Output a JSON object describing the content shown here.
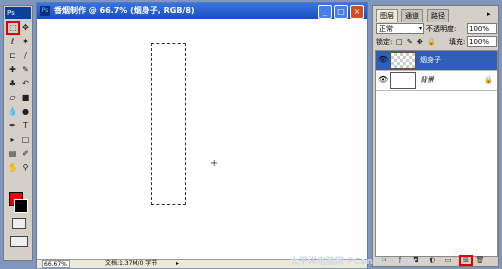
{
  "toolbox": {
    "header": "Ps",
    "tools": [
      {
        "name": "marquee-tool",
        "glyph": "⬚"
      },
      {
        "name": "move-tool",
        "glyph": "✥"
      },
      {
        "name": "lasso-tool",
        "glyph": "ℓ"
      },
      {
        "name": "magic-wand-tool",
        "glyph": "✦"
      },
      {
        "name": "crop-tool",
        "glyph": "⊏"
      },
      {
        "name": "slice-tool",
        "glyph": "/"
      },
      {
        "name": "healing-brush-tool",
        "glyph": "✚"
      },
      {
        "name": "brush-tool",
        "glyph": "✎"
      },
      {
        "name": "clone-stamp-tool",
        "glyph": "♣"
      },
      {
        "name": "history-brush-tool",
        "glyph": "↶"
      },
      {
        "name": "eraser-tool",
        "glyph": "▱"
      },
      {
        "name": "gradient-tool",
        "glyph": "■"
      },
      {
        "name": "blur-tool",
        "glyph": "💧"
      },
      {
        "name": "dodge-tool",
        "glyph": "●"
      },
      {
        "name": "pen-tool",
        "glyph": "✒"
      },
      {
        "name": "type-tool",
        "glyph": "T"
      },
      {
        "name": "path-select-tool",
        "glyph": "▸"
      },
      {
        "name": "shape-tool",
        "glyph": "□"
      },
      {
        "name": "notes-tool",
        "glyph": "▤"
      },
      {
        "name": "eyedropper-tool",
        "glyph": "✐"
      },
      {
        "name": "hand-tool",
        "glyph": "✋"
      },
      {
        "name": "zoom-tool",
        "glyph": "⚲"
      }
    ],
    "fg_color": "#ee0000",
    "bg_color": "#000000"
  },
  "document": {
    "title": "香烟制作 @ 66.7% (烟身子, RGB/8)",
    "min_glyph": "_",
    "max_glyph": "□",
    "close_glyph": "×",
    "zoom": "66.67%",
    "info": "文档:1.37M/0 字节",
    "status_arrow": "▸"
  },
  "layers_panel": {
    "tabs": [
      "图层",
      "通道",
      "路径"
    ],
    "menu_glyph": "▸",
    "blend_mode": "正常",
    "opacity_label": "不透明度:",
    "opacity": "100%",
    "lock_label": "锁定:",
    "lock_icons": "□ ✎ ✥ 🔒",
    "fill_label": "填充:",
    "fill": "100%",
    "layers": [
      {
        "name": "烟身子",
        "visible_glyph": "👁",
        "selected": true
      },
      {
        "name": "背景",
        "visible_glyph": "👁",
        "lock_glyph": "🔒"
      }
    ],
    "bottom_buttons": [
      {
        "name": "link-layers-button",
        "glyph": "∞"
      },
      {
        "name": "layer-style-button",
        "glyph": "ƒ"
      },
      {
        "name": "layer-mask-button",
        "glyph": "◘"
      },
      {
        "name": "adjustment-layer-button",
        "glyph": "◐"
      },
      {
        "name": "group-button",
        "glyph": "▭"
      },
      {
        "name": "new-layer-button",
        "glyph": "⊞"
      },
      {
        "name": "delete-layer-button",
        "glyph": "🗑"
      }
    ]
  },
  "watermark": "太平洋电脑网 PConline.com.cn"
}
